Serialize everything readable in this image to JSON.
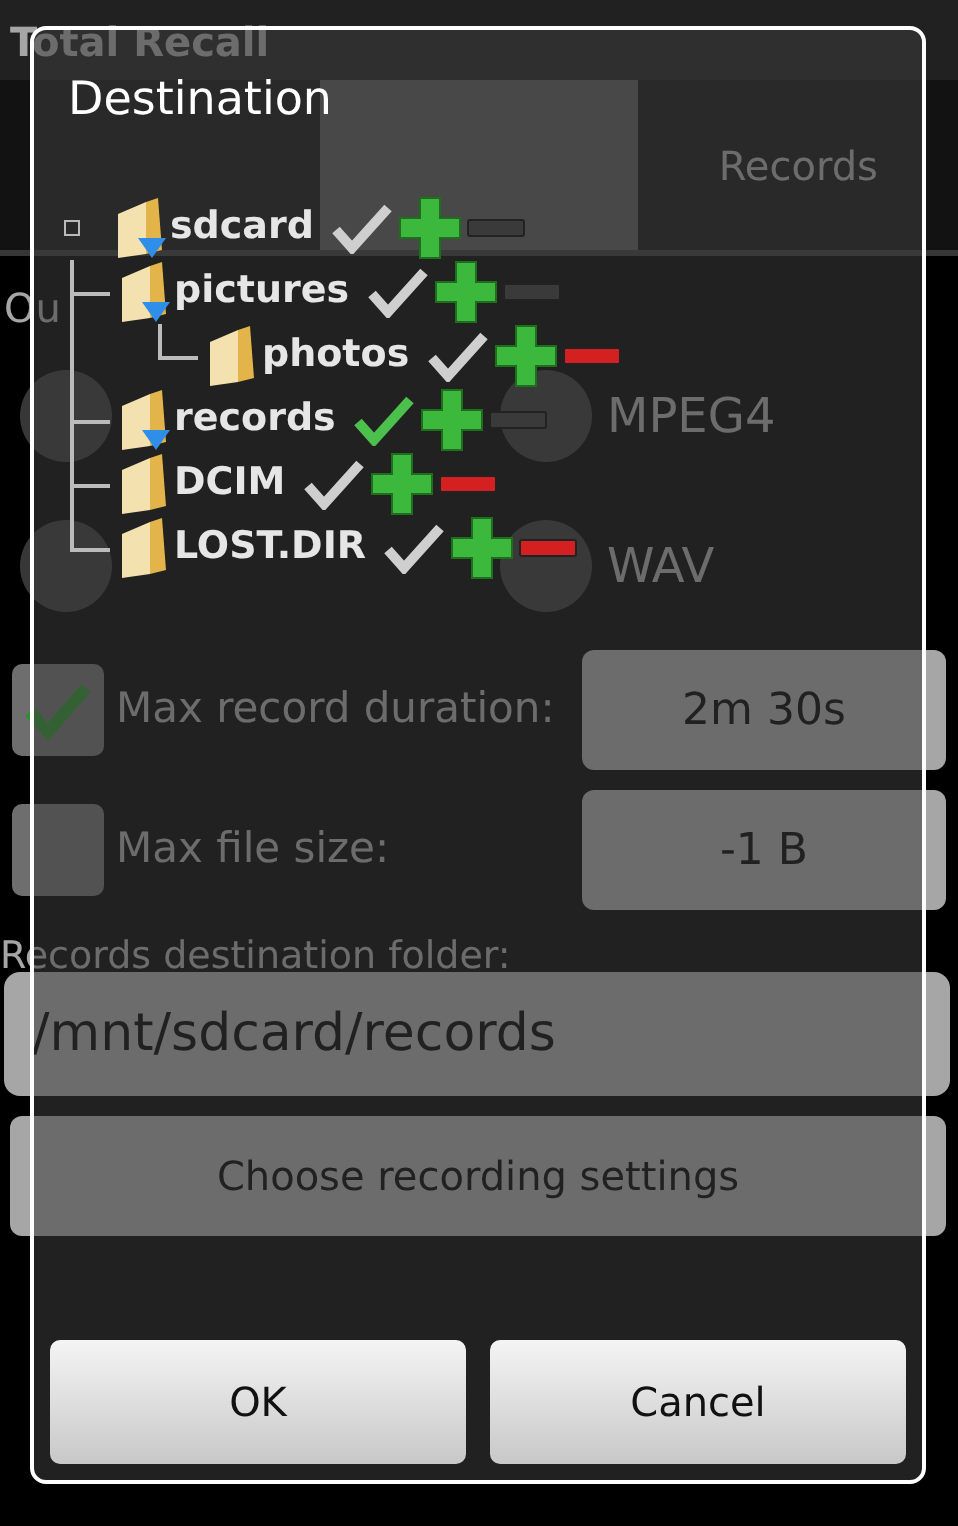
{
  "app": {
    "title": "Total Recall",
    "tabs": [
      {
        "selected": false
      },
      {
        "selected": true
      },
      {
        "label": "Records",
        "selected": false
      }
    ],
    "format_label": "Ou",
    "formats": [
      {
        "selected": false
      },
      {
        "label": "MPEG4",
        "selected": false
      },
      {
        "selected": false
      },
      {
        "label": "WAV",
        "selected": false
      }
    ],
    "limits": [
      {
        "label": "Max record duration:",
        "checked": true,
        "value": "2m 30s"
      },
      {
        "label": "Max file size:",
        "checked": false,
        "value": "-1 B"
      }
    ],
    "folder_label": "Records destination folder:",
    "folder_value": "/mnt/sdcard/records",
    "settings_button": "Choose recording settings"
  },
  "dialog": {
    "title": "Destination",
    "tree": [
      {
        "name": "sdcard",
        "has_subfolders": true,
        "selected": false,
        "removable": false,
        "children": [
          {
            "name": "pictures",
            "has_subfolders": true,
            "selected": false,
            "removable": false,
            "children": [
              {
                "name": "photos",
                "has_subfolders": false,
                "selected": false,
                "removable": true
              }
            ]
          },
          {
            "name": "records",
            "has_subfolders": true,
            "selected": true,
            "removable": false
          },
          {
            "name": "DCIM",
            "has_subfolders": false,
            "selected": false,
            "removable": true
          },
          {
            "name": "LOST.DIR",
            "has_subfolders": false,
            "selected": false,
            "removable": true
          }
        ]
      }
    ],
    "buttons": [
      "OK",
      "Cancel"
    ]
  }
}
